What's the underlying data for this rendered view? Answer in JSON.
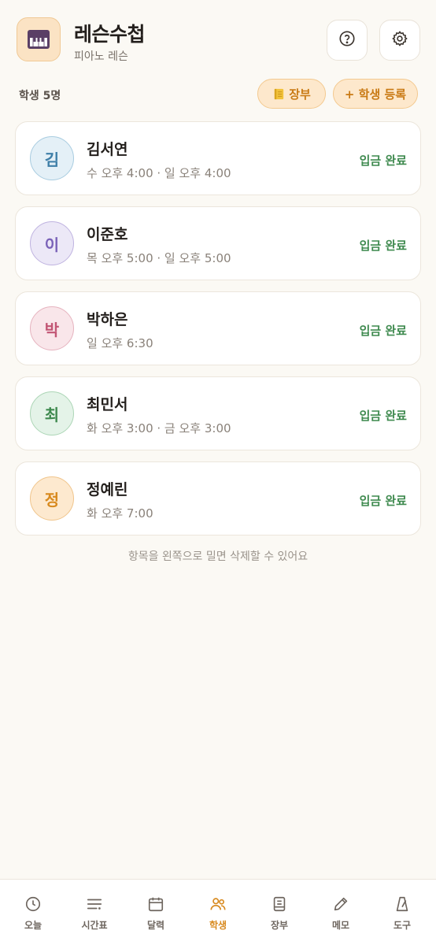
{
  "app": {
    "title": "레슨수첩",
    "subtitle": "피아노 레슨",
    "logo_icon": "piano-keys-icon",
    "accent_color": "#d88a1f"
  },
  "header": {
    "help_icon": "help-circle-icon",
    "settings_icon": "gear-icon"
  },
  "toolbar": {
    "student_count": "학생  5명",
    "ledger_label": "장부",
    "ledger_icon": "notebook-icon",
    "register_label": "+ 학생 등록"
  },
  "students": [
    {
      "initial": "김",
      "name": "김서연",
      "schedule": "수 오후 4:00 · 일 오후 4:00",
      "status": "입금 완료",
      "avatar_bg": "#e4f0f7",
      "avatar_border": "#a8cce0",
      "avatar_color": "#3f7fa8"
    },
    {
      "initial": "이",
      "name": "이준호",
      "schedule": "목 오후 5:00 · 일 오후 5:00",
      "status": "입금 완료",
      "avatar_bg": "#ece8f7",
      "avatar_border": "#bfb3e0",
      "avatar_color": "#7a62b8"
    },
    {
      "initial": "박",
      "name": "박하은",
      "schedule": "일 오후 6:30",
      "status": "입금 완료",
      "avatar_bg": "#f9e6ea",
      "avatar_border": "#e6b3bf",
      "avatar_color": "#c25574"
    },
    {
      "initial": "최",
      "name": "최민서",
      "schedule": "화 오후 3:00 · 금 오후 3:00",
      "status": "입금 완료",
      "avatar_bg": "#e4f3e8",
      "avatar_border": "#acd6b6",
      "avatar_color": "#3f8a4f"
    },
    {
      "initial": "정",
      "name": "정예린",
      "schedule": "화 오후 7:00",
      "status": "입금 완료",
      "avatar_bg": "#fde9cf",
      "avatar_border": "#f0c58c",
      "avatar_color": "#d88a1f"
    }
  ],
  "swipe_hint": "항목을 왼쪽으로 밀면 삭제할 수 있어요",
  "tabs": [
    {
      "label": "오늘",
      "icon": "clock-icon",
      "active": false
    },
    {
      "label": "시간표",
      "icon": "list-icon",
      "active": false
    },
    {
      "label": "달력",
      "icon": "calendar-icon",
      "active": false
    },
    {
      "label": "학생",
      "icon": "users-icon",
      "active": true
    },
    {
      "label": "장부",
      "icon": "book-icon",
      "active": false
    },
    {
      "label": "메모",
      "icon": "pencil-icon",
      "active": false
    },
    {
      "label": "도구",
      "icon": "metronome-icon",
      "active": false
    }
  ]
}
